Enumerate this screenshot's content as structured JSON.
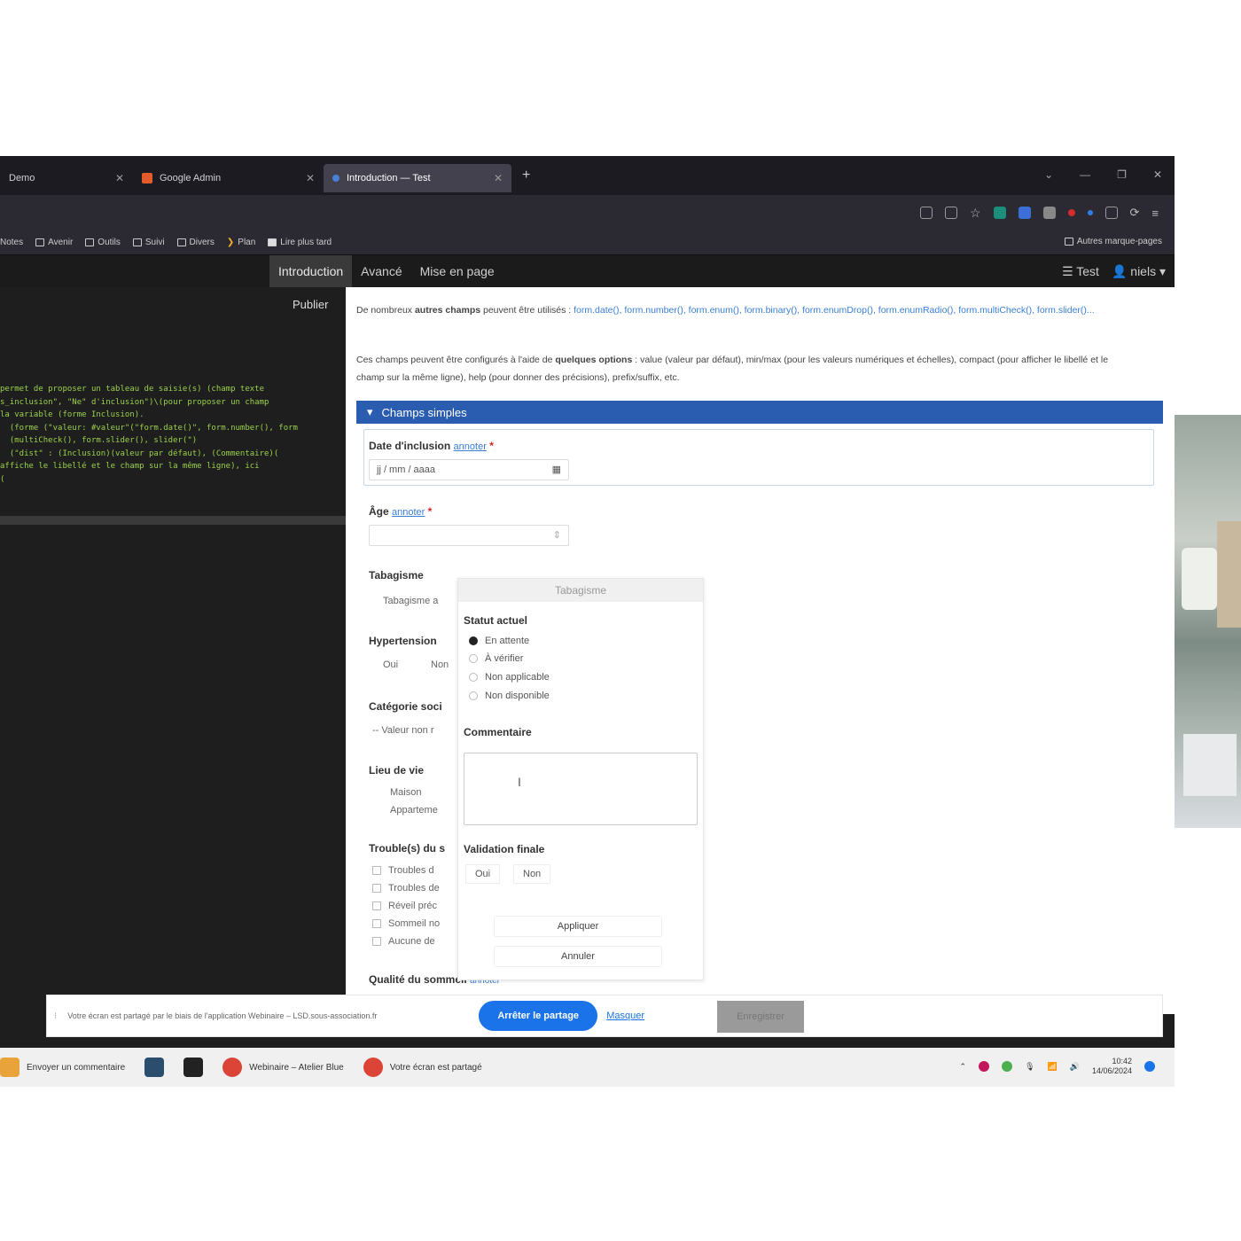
{
  "browser": {
    "tabs": [
      {
        "label": "Demo",
        "icon": "page-icon"
      },
      {
        "label": "Google Admin",
        "icon": "shield-icon"
      },
      {
        "label": "Introduction — Test",
        "icon": "app-icon",
        "active": true
      }
    ],
    "new_tab": "+",
    "bookmarks": [
      "Notes",
      "Avenir",
      "Outils",
      "Suivi",
      "Divers",
      "Plan",
      "Lire plus tard"
    ],
    "bookmarks_right": "Autres marque-pages"
  },
  "app": {
    "tabs": [
      "Introduction",
      "Avancé",
      "Mise en page"
    ],
    "right": {
      "test": "Test",
      "user": "niels"
    },
    "publish": "Publier"
  },
  "editor": {
    "code_lines": [
      "permet de proposer un tableau de saisie(s) (champ texte",
      "",
      "s_inclusion\", \"Ne\" d'inclusion\")\\(pour proposer un champ",
      "la variable (forme Inclusion).",
      "  (forme (\"valeur: #valeur\"(\"form.date()\", form.number(), form",
      "  (multiCheck(), form.slider(), slider(\")",
      "  (\"dist\" : (Inclusion)(valeur par défaut), (Commentaire)(",
      "affiche le libellé et le champ sur la même ligne), ici",
      "("
    ]
  },
  "preview": {
    "para1_prefix": "De nombreux ",
    "para1_bold": "autres champs",
    "para1_mid": " peuvent être utilisés : ",
    "para1_links": "form.date(), form.number(), form.enum(), form.binary(), form.enumDrop(), form.enumRadio(), form.multiCheck(), form.slider()...",
    "para2_prefix": "Ces champs peuvent être configurés à l'aide de ",
    "para2_bold": "quelques options",
    "para2_rest": " : value (valeur par défaut), min/max (pour les valeurs numériques et échelles), compact (pour afficher le libellé et le champ sur la même ligne), help (pour donner des précisions), prefix/suffix, etc.",
    "section": "Champs simples",
    "annotate": "annoter",
    "fields": {
      "date_label": "Date d'inclusion",
      "date_placeholder": "jj / mm / aaaa",
      "age_label": "Âge",
      "tabac_label": "Tabagisme",
      "tabac_value": "Tabagisme a",
      "hta_label": "Hypertension",
      "oui": "Oui",
      "non": "Non",
      "csp_label": "Catégorie soci",
      "csp_value": "-- Valeur non r",
      "lieu_label": "Lieu de vie",
      "lieu_opts": [
        "Maison",
        "Apparteme"
      ],
      "troubles_label": "Trouble(s) du s",
      "troubles_opts": [
        "Troubles d",
        "Troubles de",
        "Réveil préc",
        "Sommeil no",
        "Aucune de"
      ],
      "qualite_label": "Qualité du sommeil"
    },
    "popover": {
      "title": "Tabagisme",
      "status_h": "Statut actuel",
      "status_opts": [
        "En attente",
        "À vérifier",
        "Non applicable",
        "Non disponible"
      ],
      "comment_h": "Commentaire",
      "validation_h": "Validation finale",
      "oui": "Oui",
      "non": "Non",
      "apply": "Appliquer",
      "cancel": "Annuler"
    }
  },
  "sharebar": {
    "text": "Votre écran est partagé par le biais de l'application Webinaire – LSD.sous-association.fr",
    "stop": "Arrêter le partage",
    "hide": "Masquer",
    "grey": "Enregistrer"
  },
  "taskbar": {
    "items": [
      {
        "label": "Envoyer un commentaire",
        "color": "#e8a33a"
      },
      {
        "label": "",
        "color": "#2b4d6e"
      },
      {
        "label": "",
        "color": "#222222"
      },
      {
        "label": "Webinaire – Atelier Blue",
        "color": "#db4437"
      },
      {
        "label": "Votre écran est partagé",
        "color": "#db4437"
      }
    ],
    "time": "10:42",
    "date": "14/06/2024"
  },
  "colors": {
    "accent": "#2a5db0",
    "share_button": "#1a73e8",
    "code_green": "#9bd14a"
  }
}
